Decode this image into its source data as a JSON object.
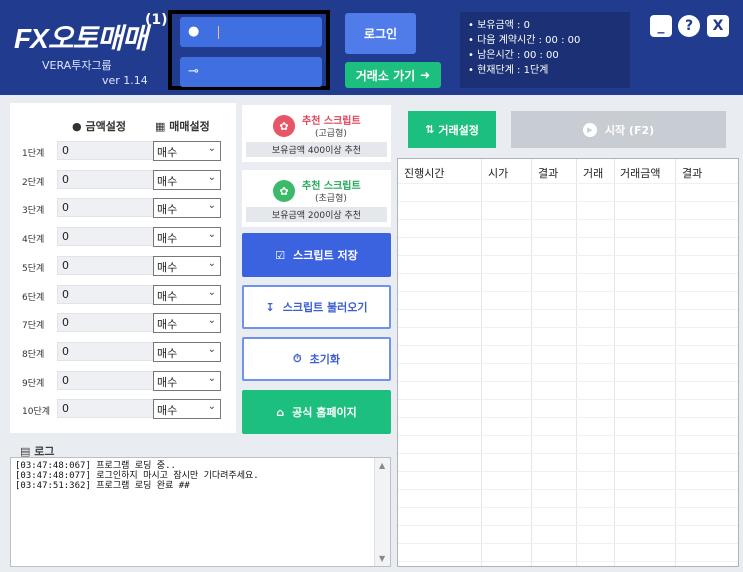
{
  "header": {
    "logo_prefix": "FX",
    "logo_name": "오토매매",
    "logo_company": "VERA투자그룹",
    "version": "ver 1.14",
    "annotation_marker": "(1)",
    "login_button": "로그인",
    "exchange_button": "거래소 가기",
    "info": [
      "• 보유금액 : 0",
      "• 다음 계약시간 : 00 : 00",
      "• 남은시간 : 00 : 00",
      "• 현재단계 : 1단계"
    ],
    "window_buttons": {
      "minimize": "_",
      "help": "?",
      "close": "X"
    }
  },
  "settings": {
    "amount_header": "금액설정",
    "trade_header": "매매설정",
    "stages": [
      {
        "label": "1단계",
        "amount": "0",
        "trade": "매수"
      },
      {
        "label": "2단계",
        "amount": "0",
        "trade": "매수"
      },
      {
        "label": "3단계",
        "amount": "0",
        "trade": "매수"
      },
      {
        "label": "4단계",
        "amount": "0",
        "trade": "매수"
      },
      {
        "label": "5단계",
        "amount": "0",
        "trade": "매수"
      },
      {
        "label": "6단계",
        "amount": "0",
        "trade": "매수"
      },
      {
        "label": "7단계",
        "amount": "0",
        "trade": "매수"
      },
      {
        "label": "8단계",
        "amount": "0",
        "trade": "매수"
      },
      {
        "label": "9단계",
        "amount": "0",
        "trade": "매수"
      },
      {
        "label": "10단계",
        "amount": "0",
        "trade": "매수"
      }
    ]
  },
  "scripts": {
    "rec_high_title": "추천 스크립트",
    "rec_high_tier": "(고급형)",
    "rec_high_note": "보유금액 400이상 추천",
    "rec_basic_title": "추천 스크립트",
    "rec_basic_tier": "(초급형)",
    "rec_basic_note": "보유금액 200이상 추천",
    "save": "스크립트 저장",
    "load": "스크립트 불러오기",
    "reset": "초기화",
    "homepage": "공식 홈페이지"
  },
  "log": {
    "title": "로그",
    "lines": [
      "[03:47:48:067] 프로그램 로딩 중..",
      "[03:47:48:077] 로그인하지 마시고 잠시만 기다려주세요.",
      "[03:47:51:362] 프로그램 로딩 완료 ##"
    ]
  },
  "trade": {
    "settings_button": "거래설정",
    "start_button": "시작 (F2)",
    "columns": [
      "진행시간",
      "시가",
      "결과",
      "거래",
      "거래금액",
      "결과"
    ]
  },
  "colors": {
    "header_bg": "#213b8e",
    "accent_blue": "#3b63e0",
    "accent_green": "#1cbf7d",
    "danger_red": "#e04455"
  }
}
